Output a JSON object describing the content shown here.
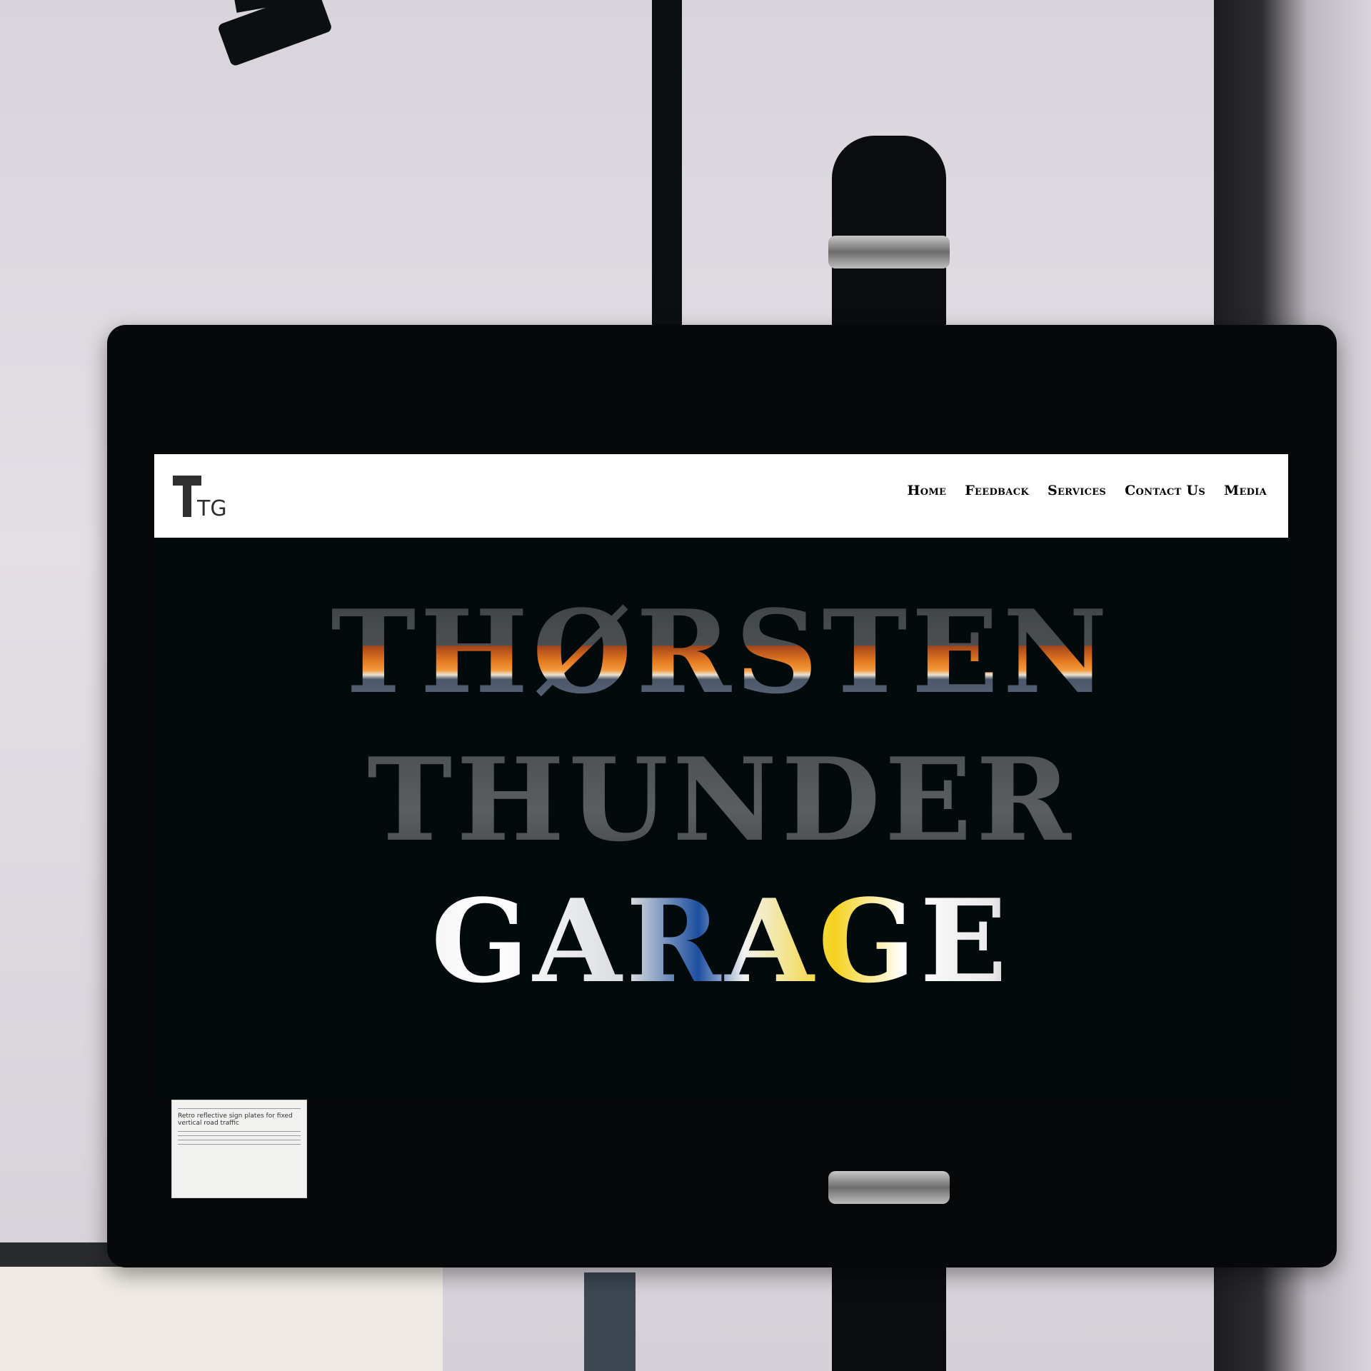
{
  "site": {
    "logo": {
      "icon": "hammer-icon",
      "text": "TG"
    },
    "nav": {
      "items": [
        {
          "label": "Home"
        },
        {
          "label": "Feedback"
        },
        {
          "label": "Services"
        },
        {
          "label": "Contact Us"
        },
        {
          "label": "Media"
        }
      ]
    },
    "hero": {
      "lines": [
        "THØRSTEN",
        "THUNDER",
        "GARAGE"
      ]
    }
  },
  "sticker": {
    "text": "Retro reflective sign plates for fixed vertical road traffic"
  },
  "colors": {
    "navbar_bg": "#ffffff",
    "hero_bg": "#020a0c",
    "accent_orange": "#e47a22",
    "board": "#060809"
  }
}
